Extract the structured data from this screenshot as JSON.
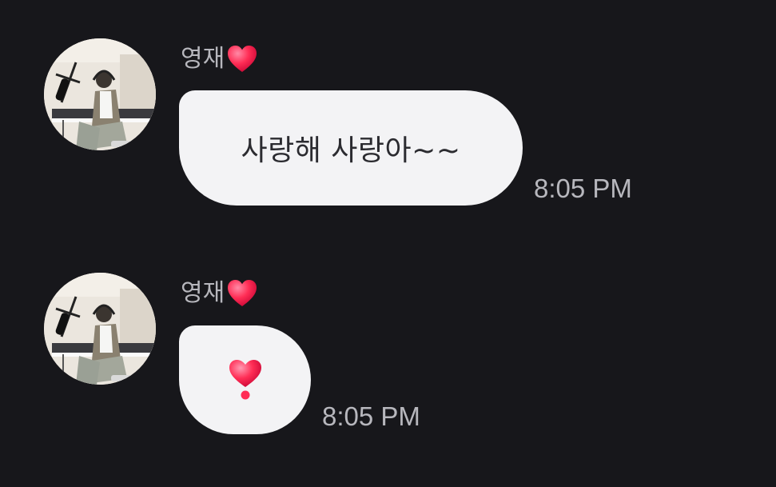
{
  "messages": [
    {
      "sender": "영재",
      "sender_badge_icon": "red-heart-icon",
      "text": "사랑해 사랑아~~",
      "time": "8:05 PM"
    },
    {
      "sender": "영재",
      "sender_badge_icon": "red-heart-icon",
      "text": "",
      "content_icon": "heart-exclamation-icon",
      "time": "8:05 PM"
    }
  ],
  "colors": {
    "background": "#17171b",
    "bubble": "#f3f3f5",
    "bubble_text": "#2b2b30",
    "meta_text": "#b7b7bd",
    "heart": "#ff2d55"
  }
}
